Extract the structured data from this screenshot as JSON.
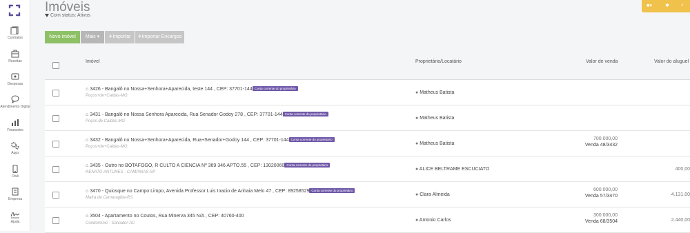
{
  "sidebar": {
    "items": [
      {
        "label": "Contratos",
        "icon": "pages-icon"
      },
      {
        "label": "Receitas",
        "icon": "receipt-icon"
      },
      {
        "label": "Despesas",
        "icon": "wallet-icon"
      },
      {
        "label": "Atendimento Digital",
        "icon": "chat-icon"
      },
      {
        "label": "Financeiro",
        "icon": "chart-icon"
      },
      {
        "label": "Apps",
        "icon": "gears-icon"
      },
      {
        "label": "Owli",
        "icon": "mobile-icon"
      },
      {
        "label": "Empresa",
        "icon": "building-icon"
      },
      {
        "label": "Ajuda",
        "icon": "signature-icon"
      }
    ]
  },
  "header": {
    "title": "Imóveis",
    "filter": "Com status: Ativos"
  },
  "toolbar": {
    "new_label": "Novo imóvel",
    "more_label": "Mais",
    "import_label": "Importar",
    "import_charges_label": "Importar Encargos"
  },
  "table": {
    "columns": {
      "property": "Imóvel",
      "owner": "Proprietário/Locatário",
      "sale": "Valor de venda",
      "rent": "Valor do aluguel"
    },
    "rows": [
      {
        "address": "3426 - Bangalô no Nossa+Senhora+Aparecida, teste 144 , CEP: 37701-144",
        "tag": "Conta corrente do proprietário",
        "city": "Poços+de+Caldas-MG",
        "owner": "Matheus Batista",
        "sale": "",
        "sale_ref": "",
        "rent": ""
      },
      {
        "address": "3431 - Bangalô no Nossa Senhora Aparecida, Rua Senador Godoy 278 , CEP: 37701-144",
        "tag": "Conta corrente do proprietário",
        "city": "Poços de Caldas-MG",
        "owner": "Matheus Batista",
        "sale": "",
        "sale_ref": "",
        "rent": ""
      },
      {
        "address": "3432 - Bangalô no Nossa+Senhora+Aparecida, Rua+Senador+Godoy 144 , CEP: 37701-144",
        "tag": "Conta corrente do proprietário",
        "city": "Poços+de+Caldas-MG",
        "owner": "Matheus Batista",
        "sale": "700.000,00",
        "sale_ref": "Venda 48/3432",
        "rent": ""
      },
      {
        "address": "3435 - Outro no BOTAFOGO, R CULTO A CIENCIA Nº 369 346 APTO.55 , CEP: 13020060",
        "tag": "Conta corrente do proprietário",
        "city": "RENATO ANTUNES - CAMPINAS-SP",
        "owner": "ALICE BELTRAME ESCUCIATO",
        "sale": "",
        "sale_ref": "",
        "rent": "400,00"
      },
      {
        "address": "3470 - Quiosque no Campo Limpo, Avenida Professor Luis Inacio de Anhaia Melo 47 , CEP: 89258529",
        "tag": "Conta corrente do proprietário",
        "city": "Mafra de Camaragibe-RS",
        "owner": "Clara Almeida",
        "sale": "600.000,00",
        "sale_ref": "Venda 57/3470",
        "rent": "4.131,00"
      },
      {
        "address": "3504 - Apartamento no Coutos, Rua Minerva 345 N/A , CEP: 40760-400",
        "tag": "",
        "city": "Condomínio - Salvador-AC",
        "owner": "Antonio Carlos",
        "sale": "300.000,00",
        "sale_ref": "Venda 68/3504",
        "rent": "2.440,00"
      }
    ]
  }
}
